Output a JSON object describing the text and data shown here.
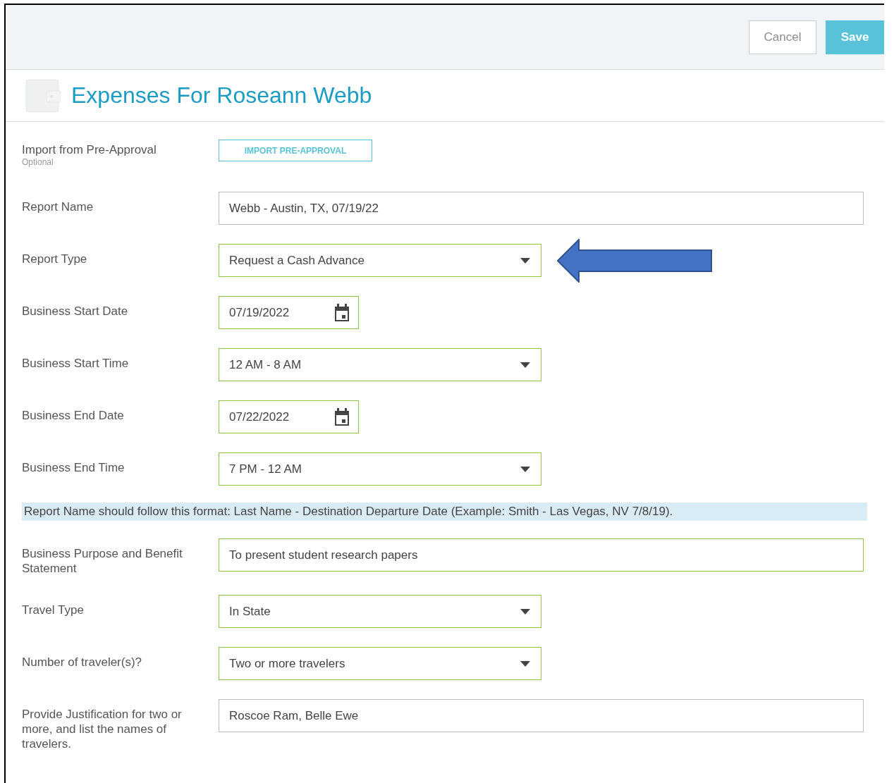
{
  "header": {
    "buttons": [
      {
        "label": "Cancel",
        "kind": "secondary"
      },
      {
        "label": "Save",
        "kind": "primary"
      }
    ]
  },
  "title": "Expenses For Roseann Webb",
  "import": {
    "label": "Import from Pre-Approval",
    "hint": "Optional",
    "button": "IMPORT PRE-APPROVAL"
  },
  "fields": [
    {
      "label": "Report Name",
      "kind": "text",
      "value": "Webb - Austin, TX, 07/19/22",
      "valid": false
    },
    {
      "label": "Report Type",
      "kind": "select",
      "value": "Request a Cash Advance",
      "valid": true,
      "annotated": true
    },
    {
      "label": "Business Start Date",
      "kind": "date",
      "value": "07/19/2022",
      "valid": true
    },
    {
      "label": "Business Start Time",
      "kind": "select",
      "value": "12 AM - 8 AM",
      "valid": true
    },
    {
      "label": "Business End Date",
      "kind": "date",
      "value": "07/22/2022",
      "valid": true
    },
    {
      "label": "Business End Time",
      "kind": "select",
      "value": "7 PM - 12 AM",
      "valid": true
    },
    {
      "kind": "note",
      "value": "Report Name should follow this format: Last Name - Destination Departure Date (Example: Smith - Las Vegas, NV 7/8/19)."
    },
    {
      "label": "Business Purpose and Benefit Statement",
      "kind": "text",
      "value": "To present student research papers",
      "valid": true
    },
    {
      "label": "Travel Type",
      "kind": "select",
      "value": "In State",
      "valid": true
    },
    {
      "label": "Number of traveler(s)?",
      "kind": "select",
      "value": "Two or more travelers",
      "valid": true
    },
    {
      "label": "Provide Justification for two or more, and list the names of travelers.",
      "kind": "text",
      "value": "Roscoe Ram, Belle Ewe",
      "valid": false
    }
  ]
}
